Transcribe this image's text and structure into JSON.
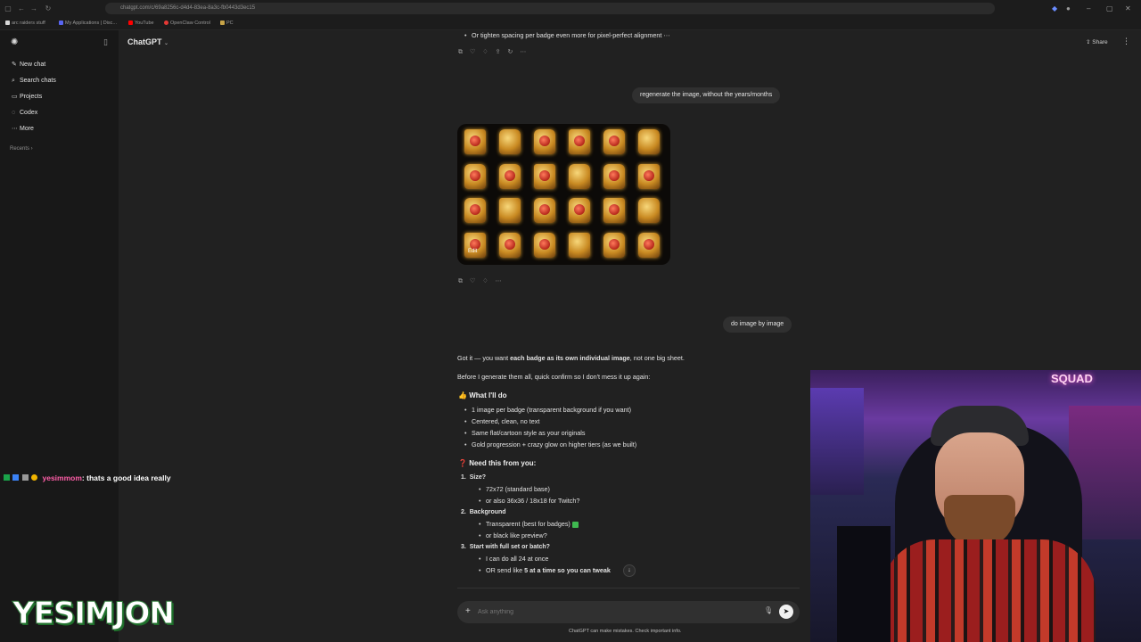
{
  "browser": {
    "url": "chatgpt.com/c/69a8256c-d4d4-83ea-8a3c-fb0443d3ec15",
    "bookmarks": [
      {
        "label": "arc raiders stuff",
        "color": "#d8d8d8"
      },
      {
        "label": "My Applications | Disc...",
        "color": "#5865f2"
      },
      {
        "label": "YouTube",
        "color": "#ff0000"
      },
      {
        "label": "OpenClaw Control",
        "color": "#e53935"
      },
      {
        "label": "PC",
        "color": "#c8a448"
      }
    ]
  },
  "sidebar": {
    "items": [
      {
        "label": "New chat",
        "icon": "✎"
      },
      {
        "label": "Search chats",
        "icon": "⌕"
      },
      {
        "label": "Projects",
        "icon": "▭"
      },
      {
        "label": "Codex",
        "icon": "◌"
      },
      {
        "label": "More",
        "icon": "⋯"
      }
    ],
    "recents_label": "Recents ›"
  },
  "header": {
    "title": "ChatGPT",
    "share_label": "Share"
  },
  "chat": {
    "prev_line": "Or tighten spacing per badge even more for pixel-perfect alignment",
    "user_msg_1": "regenerate the image, without the years/months",
    "image_edit_label": "Edit",
    "user_msg_2": "do image by image",
    "reply_intro_pre": "Got it — you want ",
    "reply_intro_bold": "each badge as its own individual image",
    "reply_intro_post": ", not one big sheet.",
    "reply_confirm": "Before I generate them all, quick confirm so I don't mess it up again:",
    "section1_title": "What I'll do",
    "section1_items": [
      "1 image per badge (transparent background if you want)",
      "Centered, clean, no text",
      "Same flat/cartoon style as your originals",
      "Gold progression + crazy glow on higher tiers (as we built)"
    ],
    "section2_title": "Need this from you:",
    "q1_title": "Size?",
    "q1_items": [
      "72x72 (standard base)",
      "or also 36x36 / 18x18 for Twitch?"
    ],
    "q2_title": "Background",
    "q2_items": [
      "Transparent (best for badges)",
      "or black like preview?"
    ],
    "q3_title": "Start with full set or batch?",
    "q3_items": [
      "I can do all 24 at once"
    ],
    "q3_last_pre": "OR send like ",
    "q3_last_bold": "5 at a time so you can tweak"
  },
  "composer": {
    "placeholder": "Ask anything",
    "footnote": "ChatGPT can make mistakes. Check important info."
  },
  "stream": {
    "chat_user": "yesimmom",
    "chat_text": ": thats a good idea really",
    "logo_text": "YESIMJON",
    "neon_sign": "SQUAD"
  },
  "colors": {
    "background": "#212121",
    "sidebar": "#181818",
    "bubble": "#303030",
    "chat_user": "#ff5ea8",
    "logo_accent": "#2f7a3a"
  }
}
